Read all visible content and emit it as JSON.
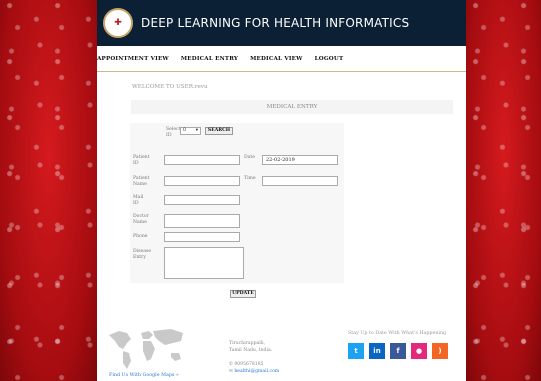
{
  "app": {
    "title": "DEEP LEARNING FOR HEALTH INFORMATICS"
  },
  "nav": {
    "items": [
      {
        "label": "APPOINTMENT VIEW"
      },
      {
        "label": "MEDICAL ENTRY"
      },
      {
        "label": "MEDICAL VIEW"
      },
      {
        "label": "LOGOUT"
      }
    ]
  },
  "welcome": "WELCOME TO USER:revu",
  "section_title": "MEDICAL ENTRY",
  "form": {
    "select_id_label": "Select ID",
    "select_value": "0",
    "search_button": "SEARCH",
    "patient_id_label": "Patient ID",
    "patient_id_value": "",
    "date_label": "Date",
    "date_value": "22-02-2019",
    "patient_name_label": "Patient Name",
    "patient_name_value": "",
    "time_label": "Time",
    "time_value": "",
    "mail_id_label": "Mail ID",
    "mail_id_value": "",
    "doctor_name_label": "Doctor Name",
    "doctor_name_value": "",
    "phone_label": "Phone",
    "phone_value": "",
    "disease_entry_label": "Disease Entry",
    "disease_entry_value": "",
    "update_button": "UPDATE"
  },
  "footer": {
    "map_link": "Find Us With Google Maps »",
    "address_line1": "Tiruchirappalli,",
    "address_line2": "Tamil Nadu, India.",
    "phone": "9095678185",
    "email": "healthi@gmail.com",
    "social_title": "Stay Up to Date With What's Happening",
    "social": [
      {
        "icon": "twitter-icon",
        "glyph": "t",
        "color": "#1da1f2"
      },
      {
        "icon": "linkedin-icon",
        "glyph": "in",
        "color": "#0a66c2"
      },
      {
        "icon": "facebook-icon",
        "glyph": "f",
        "color": "#3b5998"
      },
      {
        "icon": "flickr-icon",
        "glyph": "●",
        "color": "#e4287c"
      },
      {
        "icon": "rss-icon",
        "glyph": ")",
        "color": "#f26522"
      }
    ]
  },
  "colors": {
    "header_bg": "#0b2035",
    "background": "#b80f14",
    "link": "#2a7bd3"
  }
}
